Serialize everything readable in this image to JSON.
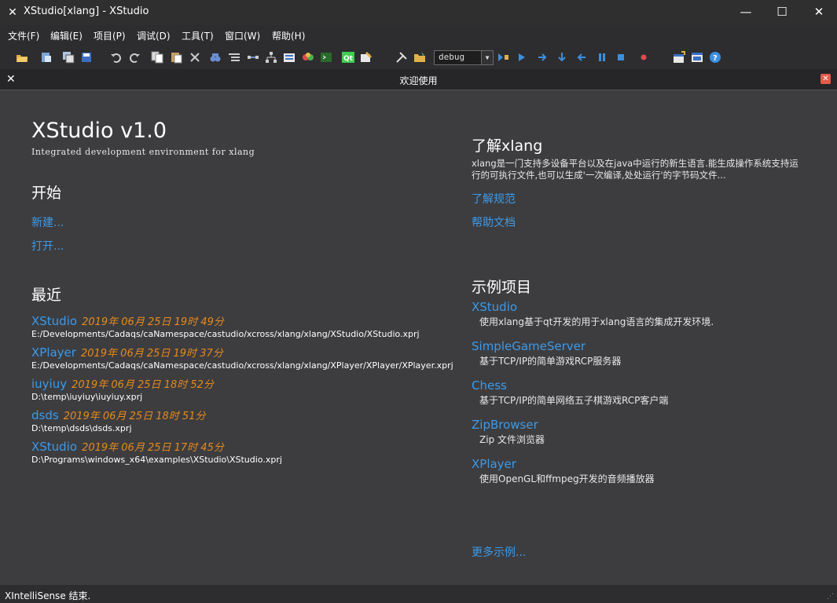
{
  "window": {
    "title": "XStudio[xlang] - XStudio",
    "minimize": "—",
    "maximize": "☐",
    "close": "✕"
  },
  "menu": [
    "文件(F)",
    "编辑(E)",
    "项目(P)",
    "调试(D)",
    "工具(T)",
    "窗口(W)",
    "帮助(H)"
  ],
  "toolbar": {
    "config_value": "debug",
    "icons": [
      "open-icon",
      "project-icon",
      "save-all-icon",
      "save-icon",
      "undo-icon",
      "redo-icon",
      "copy-icon",
      "paste-icon",
      "delete-icon",
      "find-icon",
      "list-icon",
      "connect-icon",
      "tree-icon",
      "build-icon",
      "palette-icon",
      "terminal-icon",
      "qt-icon",
      "wizard-icon",
      "tools-icon",
      "folder-open-icon",
      "run-pause-icon",
      "start-debug-icon",
      "step-over-icon",
      "step-into-icon",
      "step-out-icon",
      "pause-icon",
      "stop-icon",
      "breakpoint-icon",
      "new-window-icon",
      "layout-icon",
      "help-icon"
    ]
  },
  "tab": {
    "title": "欢迎使用"
  },
  "welcome": {
    "app_name": "XStudio v1.0",
    "tagline": "Integrated development environment for xlang",
    "start_heading": "开始",
    "new_link": "新建...",
    "open_link": "打开...",
    "recent_heading": "最近",
    "recent": [
      {
        "name": "XStudio",
        "date": "2019年 06月 25日 19时 49分",
        "path": "E:/Developments/Cadaqs/caNamespace/castudio/xcross/xlang/xlang/XStudio/XStudio.xprj"
      },
      {
        "name": "XPlayer",
        "date": "2019年 06月 25日 19时 37分",
        "path": "E:/Developments/Cadaqs/caNamespace/castudio/xcross/xlang/xlang/XPlayer/XPlayer/XPlayer.xprj"
      },
      {
        "name": "iuyiuy",
        "date": "2019年 06月 25日 18时 52分",
        "path": "D:\\temp\\iuyiuy\\iuyiuy.xprj"
      },
      {
        "name": "dsds",
        "date": "2019年 06月 25日 18时 51分",
        "path": "D:\\temp\\dsds\\dsds.xprj"
      },
      {
        "name": "XStudio",
        "date": "2019年 06月 25日 17时 45分",
        "path": "D:\\Programs\\windows_x64\\examples\\XStudio\\XStudio.xprj"
      }
    ],
    "about_heading": "了解xlang",
    "about_text_1": "xlang是一门支持多设备平台以及在java中运行的新生语言.能生成操作系统支持运",
    "about_text_2": "行的可执行文件,也可以生成'一次编译,处处运行'的字节码文件...",
    "spec_link": "了解规范",
    "docs_link": "帮助文档",
    "examples_heading": "示例项目",
    "examples": [
      {
        "name": "XStudio",
        "desc": "使用xlang基于qt开发的用于xlang语言的集成开发环境."
      },
      {
        "name": "SimpleGameServer",
        "desc": "基于TCP/IP的简单游戏RCP服务器"
      },
      {
        "name": "Chess",
        "desc": "基于TCP/IP的简单网络五子棋游戏RCP客户端"
      },
      {
        "name": "ZipBrowser",
        "desc": "Zip 文件浏览器"
      },
      {
        "name": "XPlayer",
        "desc": "使用OpenGL和ffmpeg开发的音频播放器"
      }
    ],
    "more_examples_link": "更多示例..."
  },
  "status": {
    "text": "XIntelliSense 结束."
  }
}
